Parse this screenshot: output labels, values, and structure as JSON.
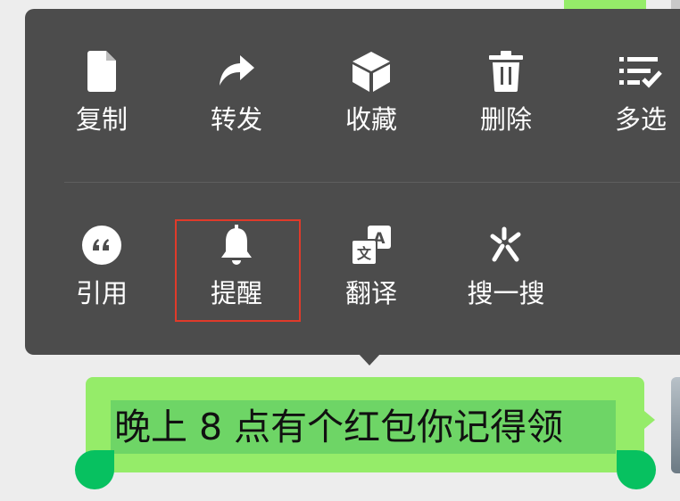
{
  "menu": {
    "row1": [
      {
        "label": "复制",
        "icon": "document-icon"
      },
      {
        "label": "转发",
        "icon": "forward-arrow-icon"
      },
      {
        "label": "收藏",
        "icon": "cube-icon"
      },
      {
        "label": "删除",
        "icon": "trash-icon"
      },
      {
        "label": "多选",
        "icon": "multi-select-icon"
      }
    ],
    "row2": [
      {
        "label": "引用",
        "icon": "quote-icon"
      },
      {
        "label": "提醒",
        "icon": "bell-icon"
      },
      {
        "label": "翻译",
        "icon": "translate-icon"
      },
      {
        "label": "搜一搜",
        "icon": "search-spark-icon"
      }
    ]
  },
  "message": {
    "text": "晚上 8 点有个红包你记得领"
  },
  "colors": {
    "menu_bg": "#4c4c4c",
    "bubble": "#95ec69",
    "selection": "#6ed566",
    "handle": "#07c160",
    "highlight_box": "#e03a2a"
  }
}
